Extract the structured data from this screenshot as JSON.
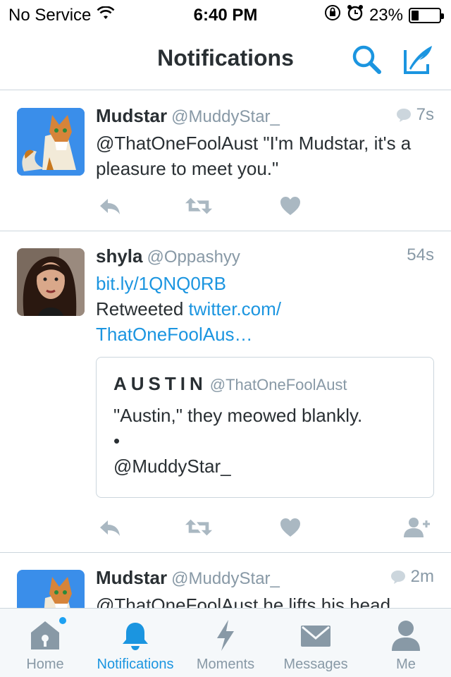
{
  "status": {
    "carrier": "No Service",
    "time": "6:40 PM",
    "battery_text": "23%",
    "battery_level": 0.23
  },
  "header": {
    "title": "Notifications"
  },
  "tweets": [
    {
      "name": "Mudstar",
      "handle": "@MuddyStar_",
      "time": "7s",
      "text": "@ThatOneFoolAust \"I'm Mudstar, it's a pleasure to meet you.\""
    },
    {
      "name": "shyla",
      "handle": "@Oppashyy",
      "time": "54s",
      "link1": "bit.ly/1QNQ0RB",
      "retweeted_label": "Retweeted",
      "link2a": "twitter.com/",
      "link2b": "ThatOneFoolAus…",
      "quote": {
        "name": "AUSTIN",
        "handle": "@ThatOneFoolAust",
        "line1": "\"Austin,\" they meowed blankly.",
        "line2": "•",
        "line3": "@MuddyStar_"
      }
    },
    {
      "name": "Mudstar",
      "handle": "@MuddyStar_",
      "time": "2m",
      "text": "@ThatOneFoolAust he lifts his head"
    }
  ],
  "tabs": [
    {
      "label": "Home",
      "icon": "home-icon"
    },
    {
      "label": "Notifications",
      "icon": "bell-icon"
    },
    {
      "label": "Moments",
      "icon": "lightning-icon"
    },
    {
      "label": "Messages",
      "icon": "envelope-icon"
    },
    {
      "label": "Me",
      "icon": "person-icon"
    }
  ],
  "colors": {
    "accent": "#1b95e0",
    "muted": "#8899a6",
    "icon_gray": "#aab8c2",
    "divider": "#ccd6dd"
  }
}
